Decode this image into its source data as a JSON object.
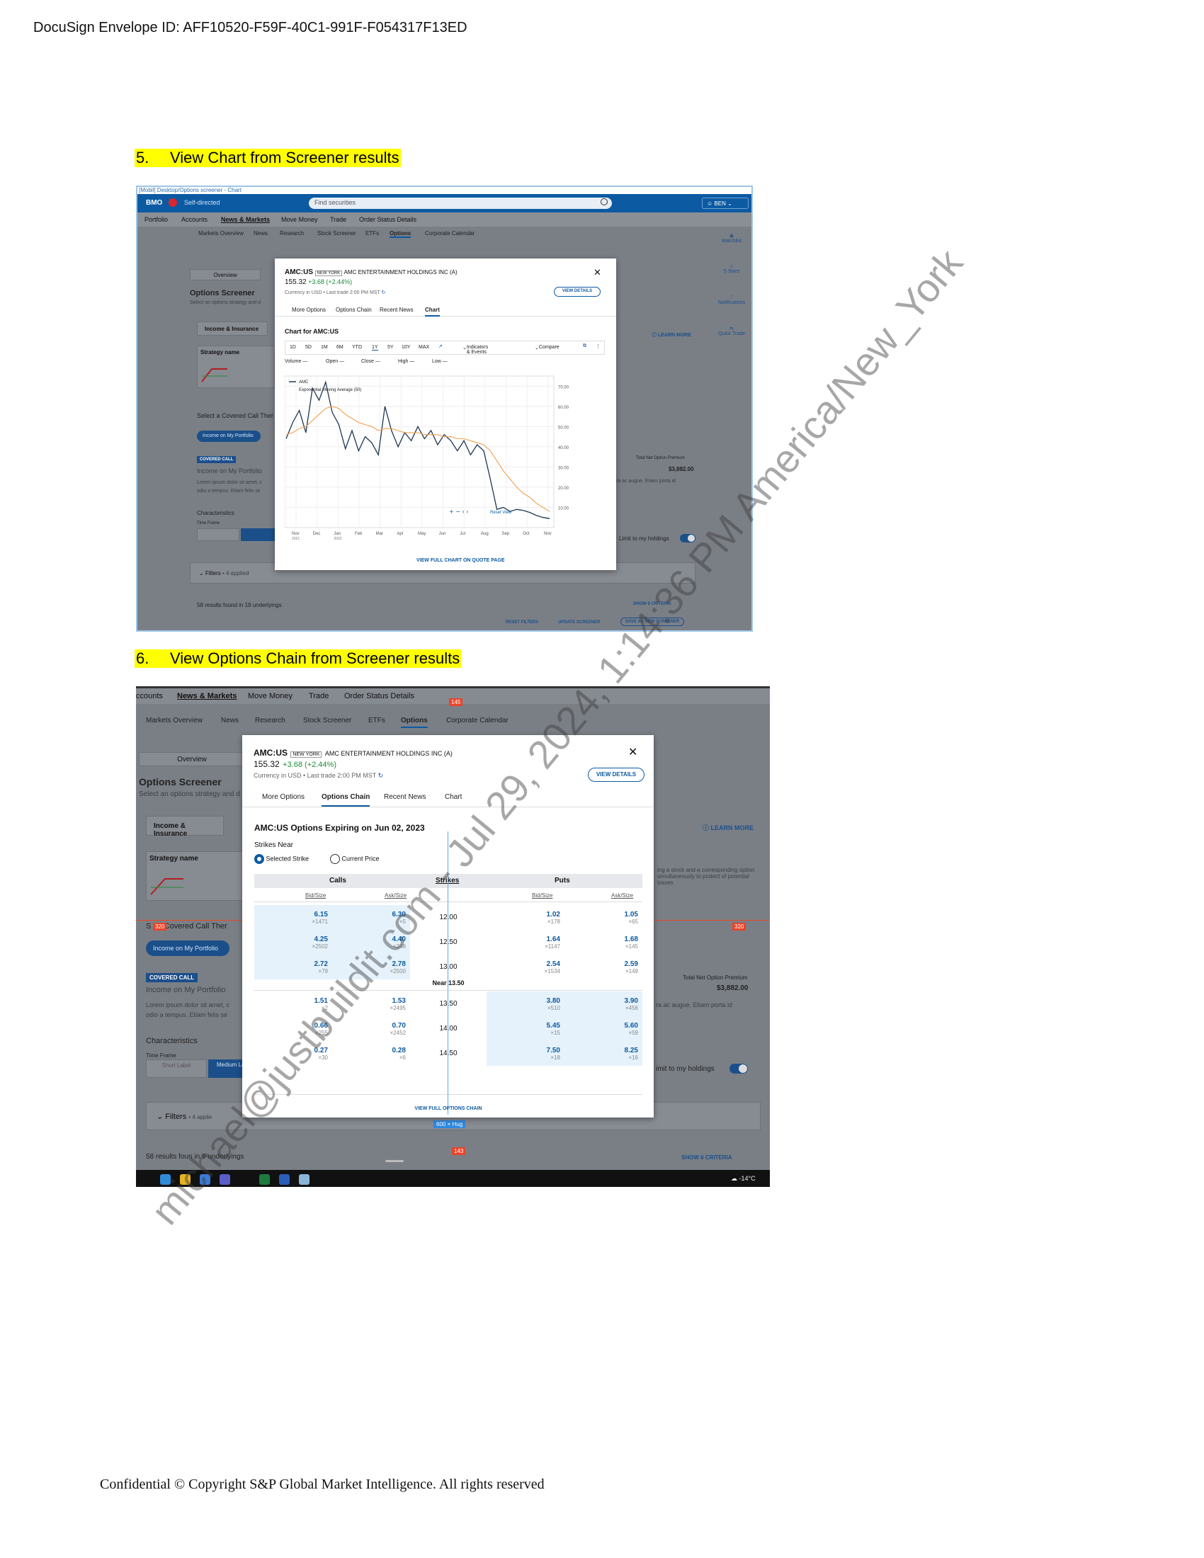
{
  "envelope": "DocuSign Envelope ID: AFF10520-F59F-40C1-991F-F054317F13ED",
  "step5": {
    "num": "5.",
    "title": "View Chart from Screener results"
  },
  "step6": {
    "num": "6.",
    "title": "View Options Chain from Screener results"
  },
  "footer": "Confidential © Copyright S&P Global Market Intelligence. All rights reserved",
  "watermark": "michael@justbuildit.com - Jul 29, 2024, 1:14:36 PM America/New_York",
  "shot1": {
    "breadcrumb": "[Mobil] Desktop/Options screener - Chart",
    "brand": "BMO",
    "self_directed": "Self-directed",
    "search_placeholder": "Find securities",
    "user": "BEN",
    "nav": [
      "Portfolio",
      "Accounts",
      "News & Markets",
      "Move Money",
      "Trade",
      "Order Status Details"
    ],
    "subnav": [
      "Markets Overview",
      "News",
      "Research",
      "Stock Screener",
      "ETFs",
      "Options",
      "Corporate Calendar"
    ],
    "side": [
      "Watchlist",
      "5 Stars",
      "Notifications",
      "Quick Trade"
    ],
    "overview": "Overview",
    "screener_title": "Options Screener",
    "screener_sub": "Select an options strategy and d",
    "income_tab": "Income & Insurance",
    "learn_more": "LEARN MORE",
    "strategy_name": "Strategy name",
    "select_covered": "Select a Covered Call Ther",
    "income_pill": "Income on My Portfolio",
    "covered_call": "COVERED CALL",
    "income_label": "Income on My Portfolio",
    "lorem": "Lorem ipsum dolor sit amet, c",
    "lorem2": "odio a tempus. Etiam felis se",
    "characteristics": "Characteristics",
    "time_frame": "Time Frame",
    "premium_label": "Total Net Option Premium",
    "premium": "$3,882.00",
    "right_text": "ra ac augue. Etiam porta id",
    "limit": "Limit to my holdings",
    "filters": "Filters",
    "applied": "• 4 applied",
    "results": "58 results found in 19 underlyings",
    "show_criteria": "SHOW 6 CRITERIA",
    "reset": "RESET FILTERS",
    "update": "UPDATE SCREENER",
    "save": "SAVE AS NEW SCREENER",
    "modal": {
      "ticker": "AMC:US",
      "exchange": "NEW YORK",
      "name": "AMC ENTERTAINMENT HOLDINGS INC (A)",
      "price": "155.32",
      "change": "+3.68 (+2.44%)",
      "currency": "Currency in USD • Last trade 2:00 PM MST",
      "view_details": "VIEW DETAILS",
      "tabs": [
        "More Options",
        "Options Chain",
        "Recent News",
        "Chart"
      ],
      "chart_for": "Chart for AMC:US",
      "ranges": [
        "1D",
        "5D",
        "1M",
        "6M",
        "YTD",
        "1Y",
        "5Y",
        "10Y",
        "MAX"
      ],
      "indicators": "Indicators & Events",
      "compare": "Compare",
      "stats": [
        "Volume —",
        "Open —",
        "Close —",
        "High —",
        "Low —"
      ],
      "reset_view": "Reset View",
      "full_chart": "VIEW FULL CHART ON QUOTE PAGE"
    }
  },
  "chart_data": {
    "type": "line",
    "series": [
      {
        "name": "AMC",
        "values": [
          44,
          52,
          58,
          47,
          69,
          63,
          72,
          57,
          51,
          39,
          48,
          38,
          45,
          42,
          36,
          60,
          48,
          40,
          47,
          43,
          50,
          44,
          48,
          41,
          46,
          43,
          38,
          43,
          36,
          41,
          38,
          24,
          9,
          10,
          8,
          9,
          8.5,
          7.5,
          6,
          5,
          4.5
        ]
      },
      {
        "name": "Exponential Moving Average (50)",
        "values": [
          46,
          47,
          49,
          50,
          53,
          56,
          59,
          60,
          59,
          56,
          54,
          52,
          51,
          50,
          48,
          49,
          49,
          48,
          47,
          47,
          47,
          46,
          46,
          46,
          45,
          45,
          44,
          44,
          43,
          42,
          41,
          38,
          33,
          28,
          24,
          20,
          17,
          15,
          12,
          10,
          8
        ]
      }
    ],
    "x_ticks": [
      "Nov 2021",
      "Dec",
      "Jan 2022",
      "Feb",
      "Mar",
      "Apr",
      "May",
      "Jun",
      "Jul",
      "Aug",
      "Sep",
      "Oct",
      "Nov"
    ],
    "y_ticks": [
      10,
      20,
      30,
      40,
      50,
      60,
      70
    ],
    "ylim": [
      0,
      75
    ],
    "legend": "top-left",
    "grid": true
  },
  "shot2": {
    "nav": [
      "ccounts",
      "News & Markets",
      "Move Money",
      "Trade",
      "Order Status Details"
    ],
    "subnav": [
      "Markets Overview",
      "News",
      "Research",
      "Stock Screener",
      "ETFs",
      "Options",
      "Corporate Calendar"
    ],
    "tag_145": "145",
    "tag_320": "320",
    "tag_hug": "600 × Hug",
    "tag_143": "143",
    "overview": "Overview",
    "screener_title": "Options Screener",
    "screener_sub": "Select an options strategy and d",
    "income_tab": "Income & Insurance",
    "learn_more": "LEARN MORE",
    "strategy_name": "Strategy name",
    "select_covered": "S    t a Covered Call Ther",
    "income_pill": "Income on My Portfolio",
    "covered_call": "COVERED CALL",
    "income_label": "Income on My Portfolio",
    "lorem": "Lorem ipsum dolor sit amet, c",
    "lorem2": "odio a tempus. Etiam felis se",
    "characteristics": "Characteristics",
    "time_frame": "Time Frame",
    "short_label": "Short Label",
    "medium_label": "Medium Label",
    "premium_label": "Total Net Option Premium",
    "premium": "$3,882.00",
    "right_text": "ra ac augue. Etiam porta id",
    "right_desc": "ing a stock and a corresponding option simultaneously to protect of potential losses",
    "limit": "imit to my holdings",
    "filters": "Filters",
    "applied": "• 4 applie",
    "results": "58 results foun  in  9 underlyings",
    "show_criteria": "SHOW 6 CRITERIA",
    "weather": "-14°C",
    "modal": {
      "ticker": "AMC:US",
      "exchange": "NEW YORK",
      "name": "AMC ENTERTAINMENT HOLDINGS INC (A)",
      "price": "155.32",
      "change": "+3.68 (+2.44%)",
      "currency": "Currency in USD • Last trade 2:00 PM MST",
      "view_details": "VIEW DETAILS",
      "tabs": [
        "More Options",
        "Options Chain",
        "Recent News",
        "Chart"
      ],
      "expiring": "AMC:US Options Expiring on Jun 02, 2023",
      "strikes_near": "Strikes Near",
      "selected_strike": "Selected Strike",
      "current_price": "Current Price",
      "calls": "Calls",
      "strikes": "Strikes",
      "puts": "Puts",
      "bid_size": "Bid/Size",
      "ask_size": "Ask/Size",
      "near": "Near 13.50",
      "rows": [
        {
          "cb": "6.15",
          "cbs": "×1471",
          "ca": "6.30",
          "cas": "×5",
          "strike": "12.00",
          "pb": "1.02",
          "pbs": "×178",
          "pa": "1.05",
          "pas": "×65"
        },
        {
          "cb": "4.25",
          "cbs": "×2502",
          "ca": "4.40",
          "cas": "×248",
          "strike": "12.50",
          "pb": "1.64",
          "pbs": "×1147",
          "pa": "1.68",
          "pas": "×145"
        },
        {
          "cb": "2.72",
          "cbs": "×79",
          "ca": "2.78",
          "cas": "×2500",
          "strike": "13.00",
          "pb": "2.54",
          "pbs": "×1534",
          "pa": "2.59",
          "pas": "×149"
        },
        {
          "cb": "1.51",
          "cbs": "×2",
          "ca": "1.53",
          "cas": "×2495",
          "strike": "13.50",
          "pb": "3.80",
          "pbs": "×510",
          "pa": "3.90",
          "pas": "×456"
        },
        {
          "cb": "0.66",
          "cbs": "×255",
          "ca": "0.70",
          "cas": "×2452",
          "strike": "14.00",
          "pb": "5.45",
          "pbs": "×15",
          "pa": "5.60",
          "pas": "×59"
        },
        {
          "cb": "0.27",
          "cbs": "×30",
          "ca": "0.28",
          "cas": "×6",
          "strike": "14.50",
          "pb": "7.50",
          "pbs": "×18",
          "pa": "8.25",
          "pas": "×16"
        }
      ],
      "full_chain": "VIEW FULL OPTIONS CHAIN"
    }
  },
  "colors": {
    "accent": "#0c5aa2",
    "positive": "#1e8c3a",
    "highlight": "#ffff00",
    "ema": "#f0a050"
  }
}
